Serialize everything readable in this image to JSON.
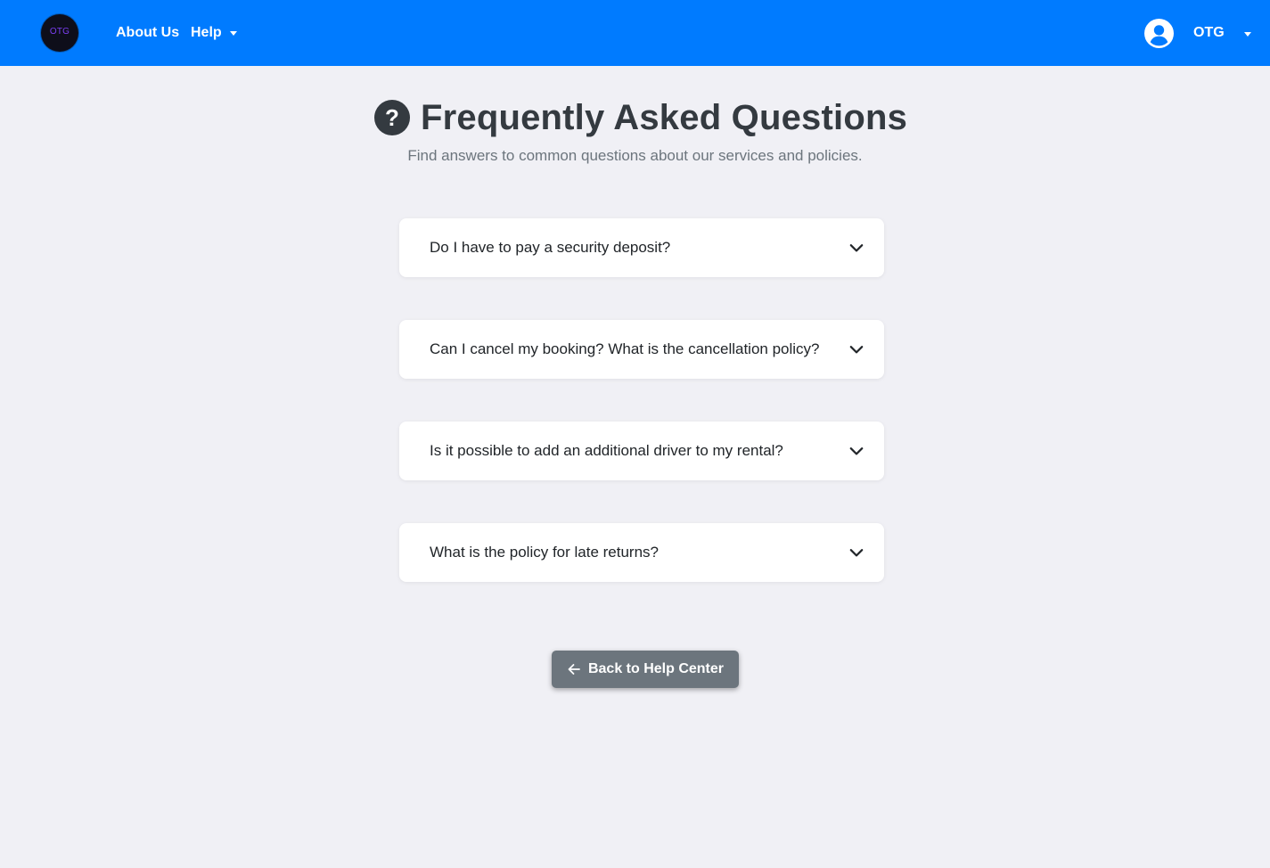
{
  "navbar": {
    "logo_text": "OTG",
    "links": {
      "about": "About Us",
      "help": "Help"
    },
    "user": {
      "name": "OTG",
      "avatar_icon": "user-circle-icon"
    },
    "background_color": "#007bff"
  },
  "header": {
    "icon": "question-circle-icon",
    "title": "Frequently Asked Questions",
    "subtitle": "Find answers to common questions about our services and policies."
  },
  "faq": {
    "items": [
      {
        "question": "Do I have to pay a security deposit?",
        "expanded": false
      },
      {
        "question": "Can I cancel my booking? What is the cancellation policy?",
        "expanded": false
      },
      {
        "question": "Is it possible to add an additional driver to my rental?",
        "expanded": false
      },
      {
        "question": "What is the policy for late returns?",
        "expanded": false
      }
    ],
    "toggle_icon": "chevron-down-icon"
  },
  "actions": {
    "back_label": "Back to Help Center",
    "back_icon": "arrow-left-icon"
  },
  "colors": {
    "page_background": "#f0f0f5",
    "button_secondary": "#6c757d",
    "title_text": "#343a40"
  }
}
